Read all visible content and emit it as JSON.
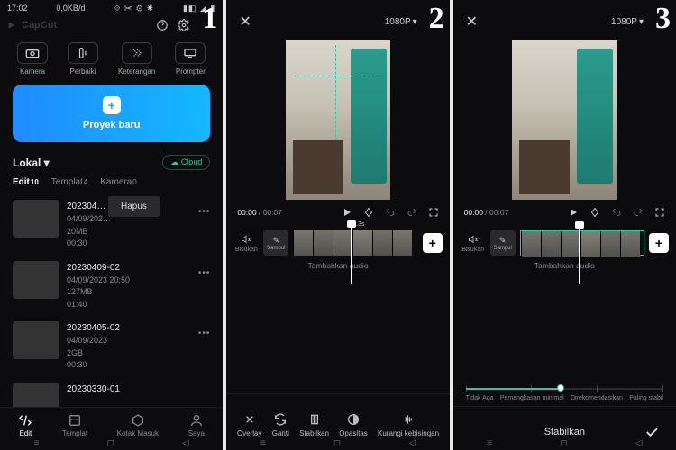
{
  "panel1": {
    "statusbar": {
      "time": "17:02",
      "net": "0,0KB/d",
      "extras": "☻ ✂ ✉ ⚙",
      "right": "📶 📶 🔋"
    },
    "logo": "CapCut",
    "tools": [
      {
        "label": "Kamera"
      },
      {
        "label": "Perbaiki"
      },
      {
        "label": "Keterangan"
      },
      {
        "label": "Prompter"
      }
    ],
    "new_project": "Proyek baru",
    "local_label": "Lokal",
    "cloud_label": "Cloud",
    "tabs": [
      {
        "label": "Edit",
        "count": "10"
      },
      {
        "label": "Templat",
        "count": "4"
      },
      {
        "label": "Kamera",
        "count": "0"
      }
    ],
    "hapus": "Hapus",
    "projects": [
      {
        "name": "202304…",
        "date": "04/09/202…",
        "size": "20MB",
        "dur": "00:30"
      },
      {
        "name": "20230409-02",
        "date": "04/09/2023 20:50",
        "size": "127MB",
        "dur": "01:40"
      },
      {
        "name": "20230405-02",
        "date": "04/09/2023",
        "size": "2GB",
        "dur": "00:30"
      },
      {
        "name": "20230330-01",
        "date": "",
        "size": "",
        "dur": ""
      }
    ],
    "bottomnav": [
      {
        "label": "Edit"
      },
      {
        "label": "Templat"
      },
      {
        "label": "Kotak Masuk"
      },
      {
        "label": "Saya"
      }
    ]
  },
  "editor": {
    "close": "✕",
    "resolution": "1080P",
    "time_cur": "00:00",
    "time_total": "00:07",
    "mute_label": "Bisukan",
    "cover_label": "Sampul",
    "clip_dur": "5.3s",
    "audio_hint": "Tambahkan audio"
  },
  "panel2": {
    "actions": [
      {
        "label": "Overlay"
      },
      {
        "label": "Ganti"
      },
      {
        "label": "Stabilkan"
      },
      {
        "label": "Opasitas"
      },
      {
        "label": "Kurangi kebisingan"
      }
    ]
  },
  "panel3": {
    "slider_labels": [
      "Tidak Ada",
      "Pemangkasan minimal",
      "Direkomendasikan",
      "Paling stabil"
    ],
    "confirm_label": "Stabilkan"
  }
}
